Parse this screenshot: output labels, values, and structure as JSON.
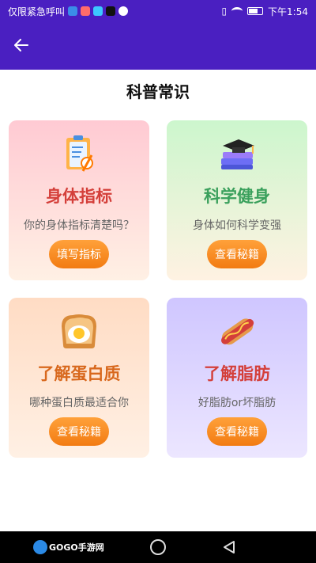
{
  "status_bar": {
    "carrier_text": "仅限紧急呼叫",
    "time": "下午1:54"
  },
  "app_bar": {
    "back_icon": "arrow-left-icon"
  },
  "page": {
    "title": "科普常识"
  },
  "cards": [
    {
      "title": "身体指标",
      "subtitle": "你的身体指标清楚吗？",
      "button": "填写指标",
      "icon": "clipboard-icon",
      "title_color": "#d43f3a"
    },
    {
      "title": "科学健身",
      "subtitle": "身体如何科学变强",
      "button": "查看秘籍",
      "icon": "books-icon",
      "title_color": "#3aa05c"
    },
    {
      "title": "了解蛋白质",
      "subtitle": "哪种蛋白质最适合你",
      "button": "查看秘籍",
      "icon": "egg-toast-icon",
      "title_color": "#d8681d"
    },
    {
      "title": "了解脂肪",
      "subtitle": "好脂肪or坏脂肪",
      "button": "查看秘籍",
      "icon": "hotdog-icon",
      "title_color": "#d43f3a"
    }
  ],
  "nav_bar": {
    "logo_text": "GOGO手游网"
  }
}
